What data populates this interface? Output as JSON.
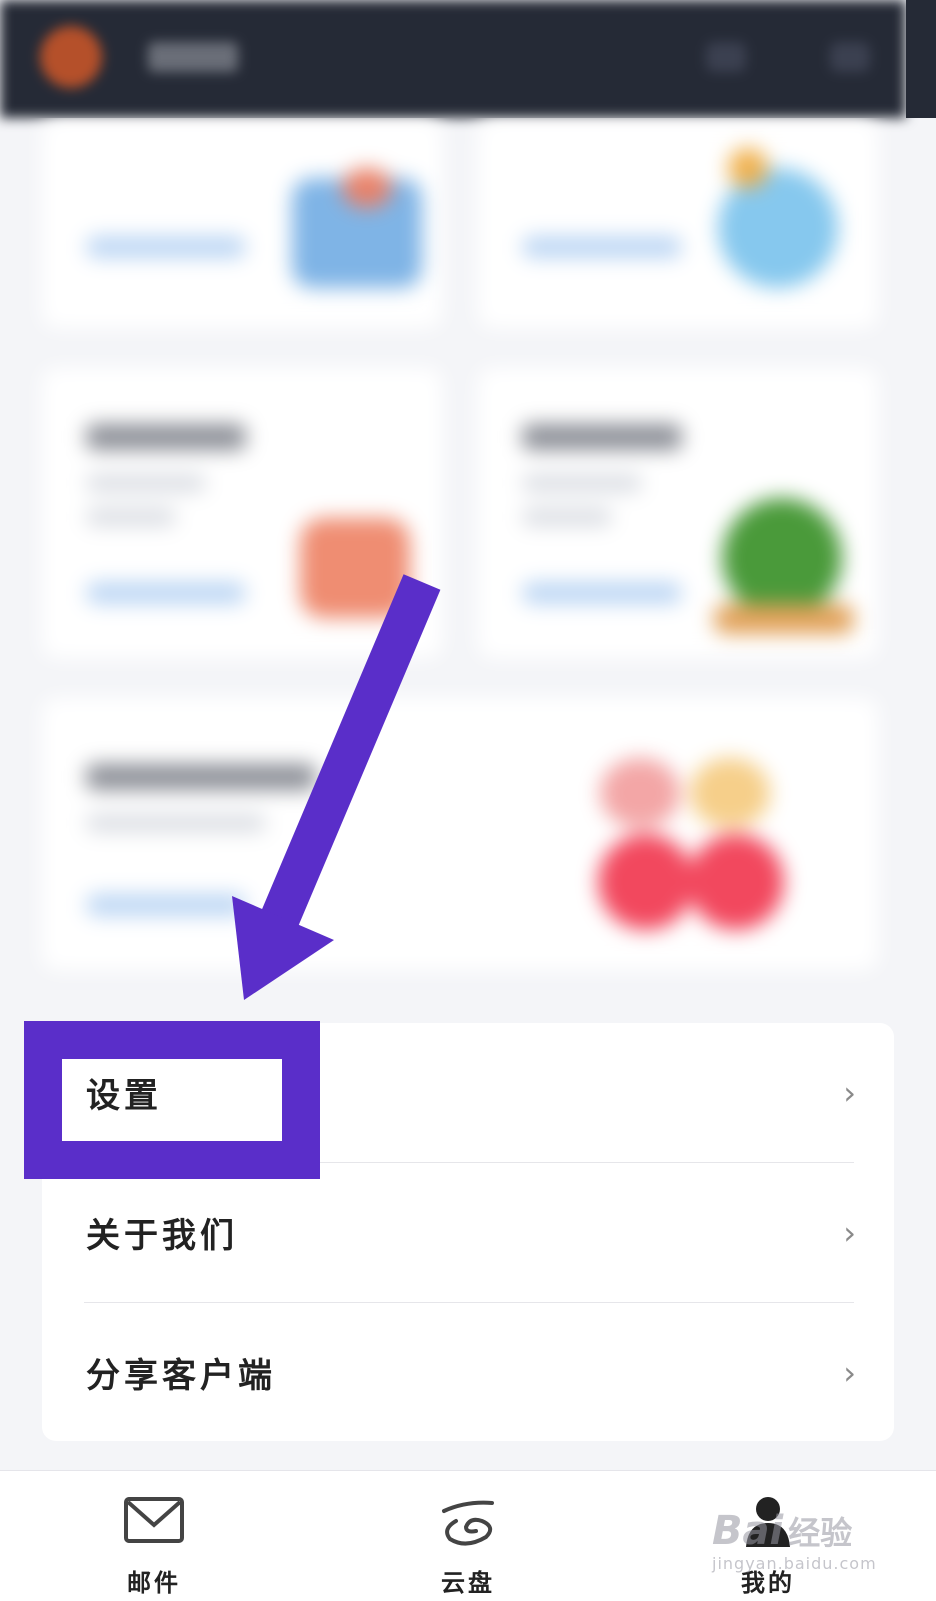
{
  "menu": {
    "items": [
      {
        "label": "设置",
        "chevron": "›"
      },
      {
        "label": "关于我们",
        "chevron": "›"
      },
      {
        "label": "分享客户端",
        "chevron": "›"
      }
    ]
  },
  "bottom_nav": {
    "items": [
      {
        "label": "邮件",
        "icon": "mail-icon"
      },
      {
        "label": "云盘",
        "icon": "cloud-drive-icon"
      },
      {
        "label": "我的",
        "icon": "profile-icon"
      }
    ]
  },
  "annotation": {
    "color": "#5a2ec9"
  },
  "watermark": {
    "brand": "Bai",
    "cn": "经验",
    "url": "jingyan.baidu.com"
  }
}
